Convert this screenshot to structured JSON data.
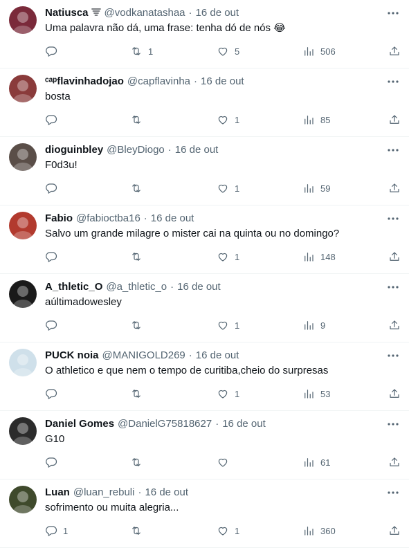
{
  "tweets": [
    {
      "name": "Natiusca",
      "badge": "tornado",
      "handle": "@vodkanatashaa",
      "date": "16 de out",
      "text": "Uma palavra não dá, uma frase: tenha dó de nós 😂",
      "replies": "",
      "retweets": "1",
      "likes": "5",
      "views": "506",
      "avatar_color": "#7a2a3a"
    },
    {
      "name": "ᶜᵃᵖflavinhadojao",
      "badge": "",
      "handle": "@capflavinha",
      "date": "16 de out",
      "text": "bosta",
      "replies": "",
      "retweets": "",
      "likes": "1",
      "views": "85",
      "avatar_color": "#8a3b3b"
    },
    {
      "name": "dioguinbley",
      "badge": "",
      "handle": "@BleyDiogo",
      "date": "16 de out",
      "text": "F0d3u!",
      "replies": "",
      "retweets": "",
      "likes": "1",
      "views": "59",
      "avatar_color": "#5a4e48"
    },
    {
      "name": "Fabio",
      "badge": "",
      "handle": "@fabioctba16",
      "date": "16 de out",
      "text": "Salvo um grande milagre o mister cai na quinta ou no domingo?",
      "replies": "",
      "retweets": "",
      "likes": "1",
      "views": "148",
      "avatar_color": "#b23a2e"
    },
    {
      "name": "A_thletic_O",
      "badge": "",
      "handle": "@a_thletic_o",
      "date": "16 de out",
      "text": "aúltimadowesley",
      "replies": "",
      "retweets": "",
      "likes": "1",
      "views": "9",
      "avatar_color": "#1a1a1a"
    },
    {
      "name": "PUCK noia",
      "badge": "",
      "handle": "@MANIGOLD269",
      "date": "16 de out",
      "text": "O athletico e que nem o tempo de curitiba,cheio do surpresas",
      "replies": "",
      "retweets": "",
      "likes": "1",
      "views": "53",
      "avatar_color": "#cfe0ea"
    },
    {
      "name": "Daniel Gomes",
      "badge": "",
      "handle": "@DanielG75818627",
      "date": "16 de out",
      "text": "G10",
      "replies": "",
      "retweets": "",
      "likes": "",
      "views": "61",
      "avatar_color": "#2b2b2b"
    },
    {
      "name": "Luan",
      "badge": "",
      "handle": "@luan_rebuli",
      "date": "16 de out",
      "text": "sofrimento ou muita alegria...",
      "replies": "1",
      "retweets": "",
      "likes": "1",
      "views": "360",
      "avatar_color": "#3f4a2c"
    }
  ]
}
